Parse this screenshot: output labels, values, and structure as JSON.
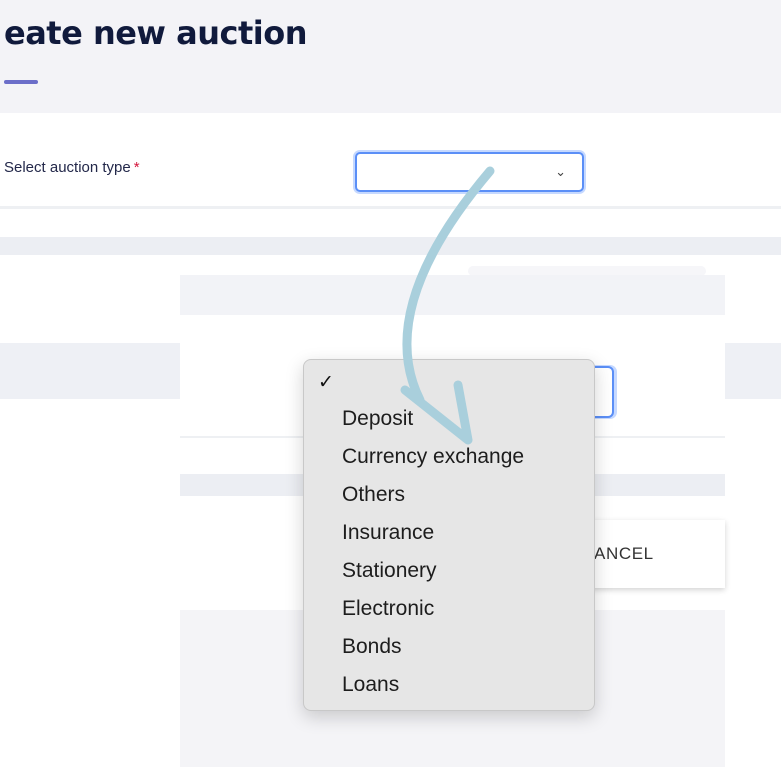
{
  "header": {
    "title": "eate new auction"
  },
  "form": {
    "auction_type_label": "Select auction type",
    "required_marker": "*",
    "select_chevron": "⌄"
  },
  "dialog": {
    "cancel_label": "ANCEL"
  },
  "dropdown": {
    "check": "✓",
    "options": [
      "Deposit",
      "Currency exchange",
      "Others",
      "Insurance",
      "Stationery",
      "Electronic",
      "Bonds",
      "Loans"
    ]
  },
  "colors": {
    "accent": "#5b8ff7",
    "title": "#101a3c",
    "underline": "#6b6ec9",
    "required": "#d4163c",
    "arrow": "#a9cfdc"
  }
}
